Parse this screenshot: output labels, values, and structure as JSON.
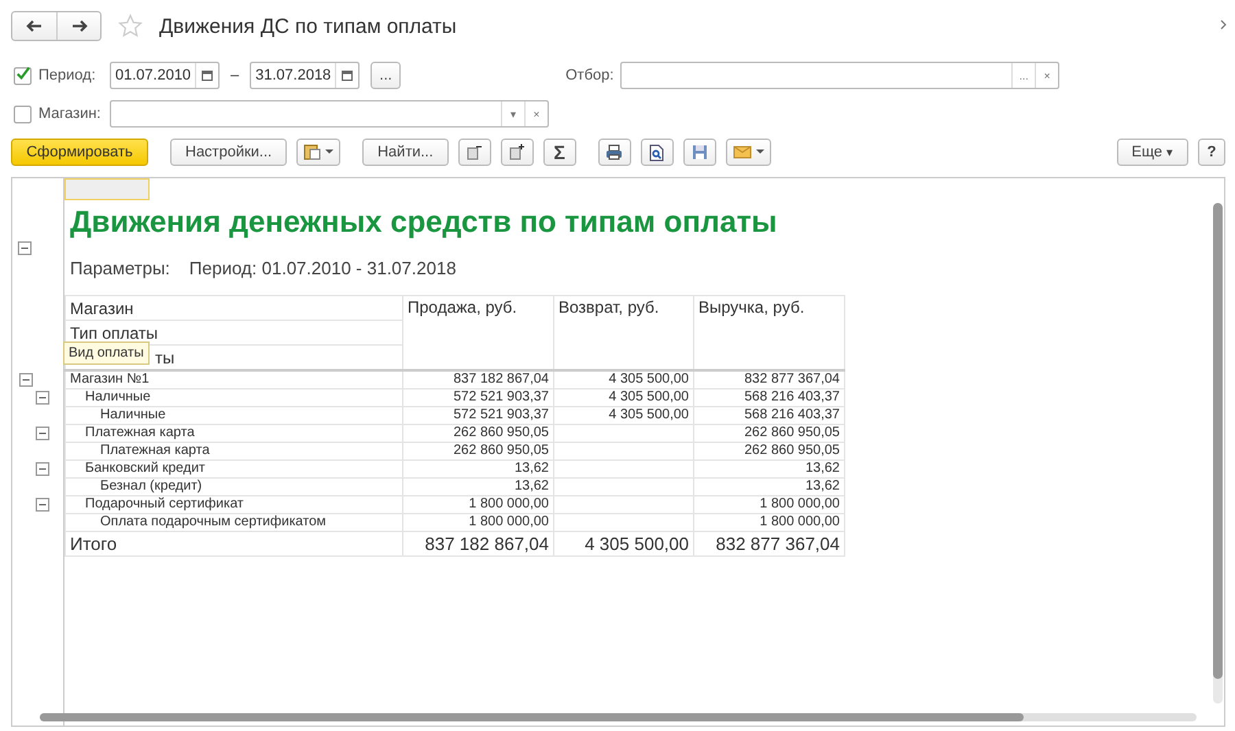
{
  "window": {
    "title": "Движения ДС по типам оплаты"
  },
  "filters": {
    "period": {
      "checked": true,
      "label": "Период:",
      "from": "01.07.2010",
      "dash": "–",
      "to": "31.07.2018",
      "more": "..."
    },
    "selection": {
      "label": "Отбор:",
      "more": "...",
      "clear": "×"
    },
    "store": {
      "checked": false,
      "label": "Магазин:",
      "dropdown": "▾",
      "clear": "×"
    }
  },
  "toolbar": {
    "generate": "Сформировать",
    "settings": "Настройки...",
    "find": "Найти...",
    "sum": "Σ",
    "more": "Еще",
    "more_caret": "▾",
    "help": "?"
  },
  "report": {
    "title": "Движения денежных средств по типам оплаты",
    "params_label": "Параметры:",
    "params_value": "Период: 01.07.2010 - 31.07.2018",
    "header_rows": [
      "Магазин",
      "Тип оплаты",
      "ты"
    ],
    "columns": [
      "Продажа, руб.",
      "Возврат, руб.",
      "Выручка, руб."
    ],
    "tooltip": "Вид оплаты",
    "rows": [
      {
        "name": "Магазин №1",
        "sales": "837 182 867,04",
        "returns": "4 305 500,00",
        "revenue": "832 877 367,04",
        "expanded": true,
        "children": [
          {
            "name": "Наличные",
            "sales": "572 521 903,37",
            "returns": "4 305 500,00",
            "revenue": "568 216 403,37",
            "expanded": true,
            "children": [
              {
                "name": "Наличные",
                "sales": "572 521 903,37",
                "returns": "4 305 500,00",
                "revenue": "568 216 403,37"
              }
            ]
          },
          {
            "name": "Платежная карта",
            "sales": "262 860 950,05",
            "revenue": "262 860 950,05",
            "expanded": true,
            "children": [
              {
                "name": "Платежная карта",
                "sales": "262 860 950,05",
                "revenue": "262 860 950,05"
              }
            ]
          },
          {
            "name": "Банковский кредит",
            "sales": "13,62",
            "revenue": "13,62",
            "expanded": true,
            "children": [
              {
                "name": "Безнал (кредит)",
                "sales": "13,62",
                "revenue": "13,62"
              }
            ]
          },
          {
            "name": "Подарочный сертификат",
            "sales": "1 800 000,00",
            "revenue": "1 800 000,00",
            "expanded": true,
            "children": [
              {
                "name": "Оплата подарочным сертификатом",
                "sales": "1 800 000,00",
                "revenue": "1 800 000,00"
              }
            ]
          }
        ]
      }
    ],
    "total": {
      "label": "Итого",
      "sales": "837 182 867,04",
      "returns": "4 305 500,00",
      "revenue": "832 877 367,04"
    }
  }
}
